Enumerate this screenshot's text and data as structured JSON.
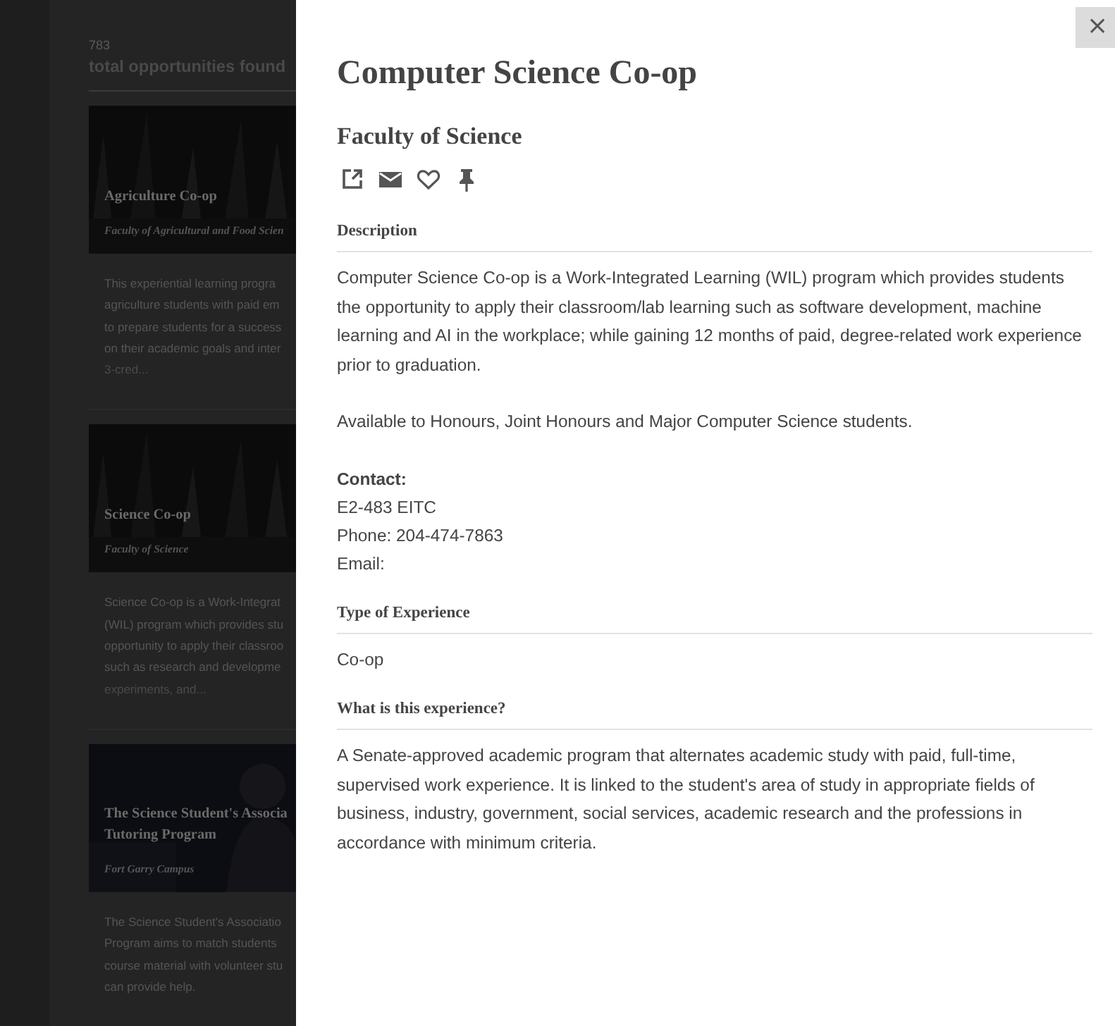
{
  "results": {
    "count": "783",
    "label": "total opportunities found",
    "cards": [
      {
        "kind": "picture",
        "title": [
          "Agriculture Co-op"
        ],
        "subtitle": "Faculty of Agricultural and Food Scien",
        "description": [
          "This experiential learning progra",
          "agriculture students with paid em",
          "to prepare students for a success",
          "on their academic goals and inter"
        ],
        "more": "3-cred..."
      },
      {
        "kind": "picture",
        "title": [
          "Science Co-op"
        ],
        "subtitle": "Faculty of Science",
        "description": [
          "Science Co-op is a Work-Integrat",
          "(WIL) program which provides stu",
          "opportunity to apply their classroo",
          "such as research and developme"
        ],
        "more": "experiments, and..."
      },
      {
        "kind": "picture",
        "title": [
          "The Science Student's Associa",
          "Tutoring Program"
        ],
        "subtitle": "Fort Garry Campus",
        "description": [
          "The Science Student's Associatio",
          "Program aims to match students",
          "course material with volunteer stu",
          "can provide help."
        ]
      }
    ]
  },
  "detail": {
    "close": "×",
    "title": "Computer Science Co-op",
    "subtitle": "Faculty of Science",
    "actions": [
      {
        "kind": "external-link"
      },
      {
        "kind": "mail"
      },
      {
        "kind": "heart"
      },
      {
        "kind": "pin"
      }
    ],
    "sections": [
      {
        "heading": "Description",
        "paragraphs": [
          "Computer Science Co-op is a Work-Integrated Learning (WIL) program which provides students the opportunity to apply their classroom/lab learning such as software development, machine learning and AI in the workplace; while gaining 12 months of paid, degree-related work experience prior to graduation.",
          "Available to Honours, Joint Honours and Major Computer Science students."
        ],
        "contact": {
          "heading": "Contact:",
          "lines": [
            "E2-483 EITC",
            "Phone: 204-474-7863",
            "Email:"
          ]
        }
      },
      {
        "heading": "Type of Experience",
        "paragraphs": [
          "Co-op"
        ]
      },
      {
        "heading": "What is this experience?",
        "paragraphs": [
          "A Senate-approved academic program that alternates academic study with paid, full-time, supervised work experience. It is linked to the student's area of study in appropriate fields of business, industry, government, social services, academic research and the professions in accordance with minimum criteria."
        ]
      }
    ]
  }
}
